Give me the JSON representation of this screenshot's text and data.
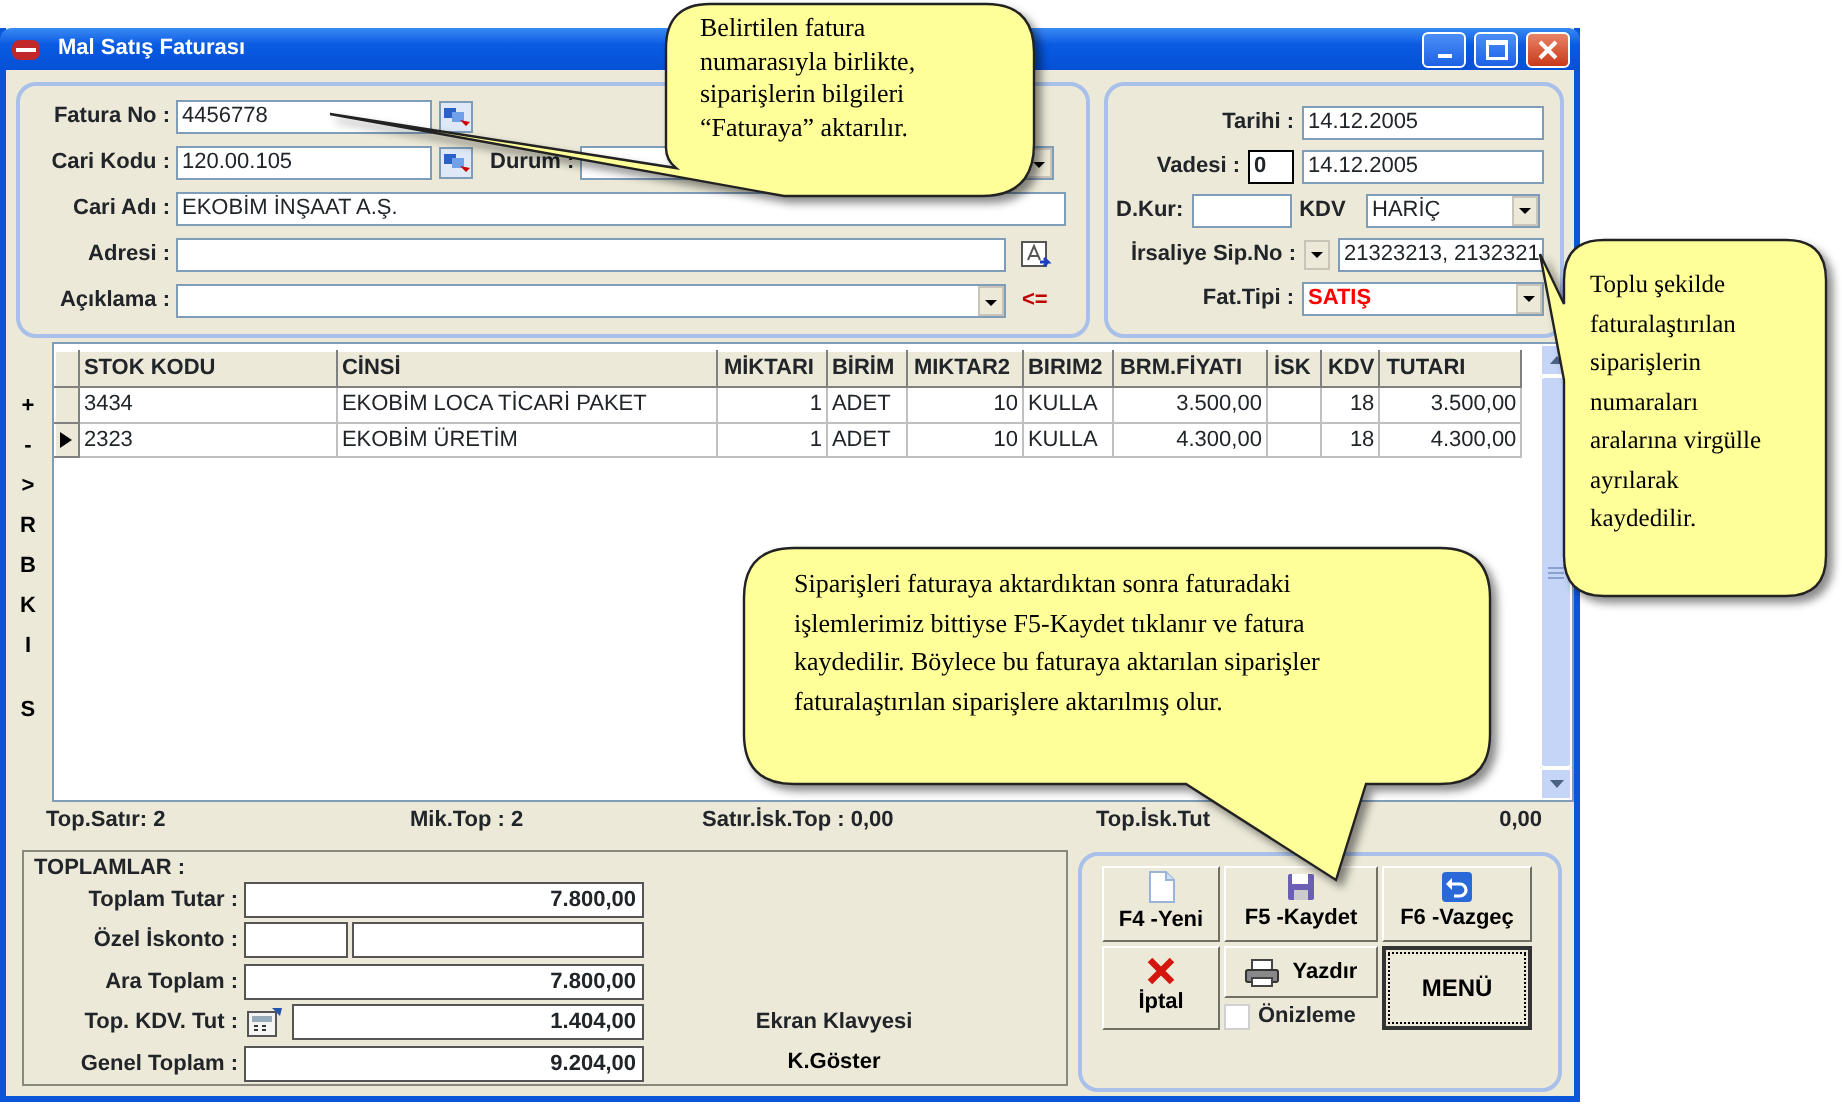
{
  "window": {
    "title": "Mal Satış Faturası"
  },
  "header_left": {
    "fatura_no": {
      "label": "Fatura No :",
      "value": "4456778"
    },
    "cari_kodu": {
      "label": "Cari Kodu :",
      "value": "120.00.105"
    },
    "durum": {
      "label": "Durum :"
    },
    "cari_adi": {
      "label": "Cari Adı :",
      "value": "EKOBİM İNŞAAT A.Ş."
    },
    "adresi": {
      "label": "Adresi :"
    },
    "aciklama": {
      "label": "Açıklama :",
      "action": "<="
    }
  },
  "header_right": {
    "tarihi": {
      "label": "Tarihi :",
      "value": "14.12.2005"
    },
    "vadesi": {
      "label": "Vadesi :",
      "days": "0",
      "value": "14.12.2005"
    },
    "d_kur": {
      "label": "D.Kur:"
    },
    "kdv": {
      "label": "KDV",
      "value": "HARİÇ"
    },
    "irsaliye": {
      "label": "İrsaliye Sip.No :",
      "value": "21323213, 2132321"
    },
    "fat_tipi": {
      "label": "Fat.Tipi :",
      "value": "SATIŞ"
    }
  },
  "side_toolbar": [
    "+",
    "-",
    ">",
    "R",
    "B",
    "K",
    "I",
    "S"
  ],
  "table": {
    "columns": [
      {
        "label": "STOK KODU",
        "numeric": false
      },
      {
        "label": "CİNSİ",
        "numeric": false
      },
      {
        "label": "MİKTARI",
        "numeric": true
      },
      {
        "label": "BİRİM",
        "numeric": false
      },
      {
        "label": "MIKTAR2",
        "numeric": true
      },
      {
        "label": "BIRIM2",
        "numeric": false
      },
      {
        "label": "BRM.FİYATI",
        "numeric": true
      },
      {
        "label": "İSK",
        "numeric": true
      },
      {
        "label": "KDV",
        "numeric": true
      },
      {
        "label": "TUTARI",
        "numeric": true
      }
    ],
    "rows": [
      {
        "current": false,
        "cells": [
          "3434",
          "EKOBİM LOCA TİCARİ PAKET",
          "1",
          "ADET",
          "10",
          "KULLA",
          "3.500,00",
          "",
          "18",
          "3.500,00"
        ]
      },
      {
        "current": true,
        "cells": [
          "2323",
          "EKOBİM ÜRETİM",
          "1",
          "ADET",
          "10",
          "KULLA",
          "4.300,00",
          "",
          "18",
          "4.300,00"
        ]
      }
    ]
  },
  "summary": [
    "Top.Satır: 2",
    "Mik.Top : 2",
    "Satır.İsk.Top : 0,00",
    "Top.İsk.Tut",
    "0,00"
  ],
  "totals": {
    "title": "TOPLAMLAR :",
    "rows": [
      {
        "kind": "value",
        "label": "Toplam Tutar :",
        "value": "7.800,00"
      },
      {
        "kind": "split",
        "label": "Özel İskonto :"
      },
      {
        "kind": "value",
        "label": "Ara Toplam :",
        "value": "7.800,00"
      },
      {
        "kind": "icon",
        "label": "Top. KDV. Tut :",
        "value": "1.404,00"
      },
      {
        "kind": "value",
        "label": "Genel Toplam :",
        "value": "9.204,00"
      }
    ],
    "keyboard": {
      "title": "Ekran Klavyesi",
      "button": "K.Göster"
    }
  },
  "actions": {
    "buttons": [
      {
        "kind": "new",
        "label": "F4 -Yeni"
      },
      {
        "kind": "save",
        "label": "F5 -Kaydet"
      },
      {
        "kind": "cancel",
        "label": "F6 -Vazgeç"
      },
      {
        "kind": "delete",
        "label": "İptal"
      },
      {
        "kind": "print",
        "label": "Yazdır"
      },
      {
        "kind": "menu",
        "label": "MENÜ"
      }
    ],
    "preview": {
      "label": "Önizleme",
      "checked": false
    }
  },
  "callouts": [
    "Belirtilen fatura numarasıyla birlikte, siparişlerin bilgileri “Faturaya” aktarılır.",
    "Toplu şekilde faturalaştırılan siparişlerin numaraları aralarına virgülle ayrılarak kaydedilir.",
    "Siparişleri faturaya aktardıktan sonra faturadaki işlemlerimiz bittiyse F5-Kaydet tıklanır ve fatura kaydedilir. Böylece bu faturaya aktarılan siparişler faturalaştırılan siparişlere aktarılmış olur."
  ]
}
